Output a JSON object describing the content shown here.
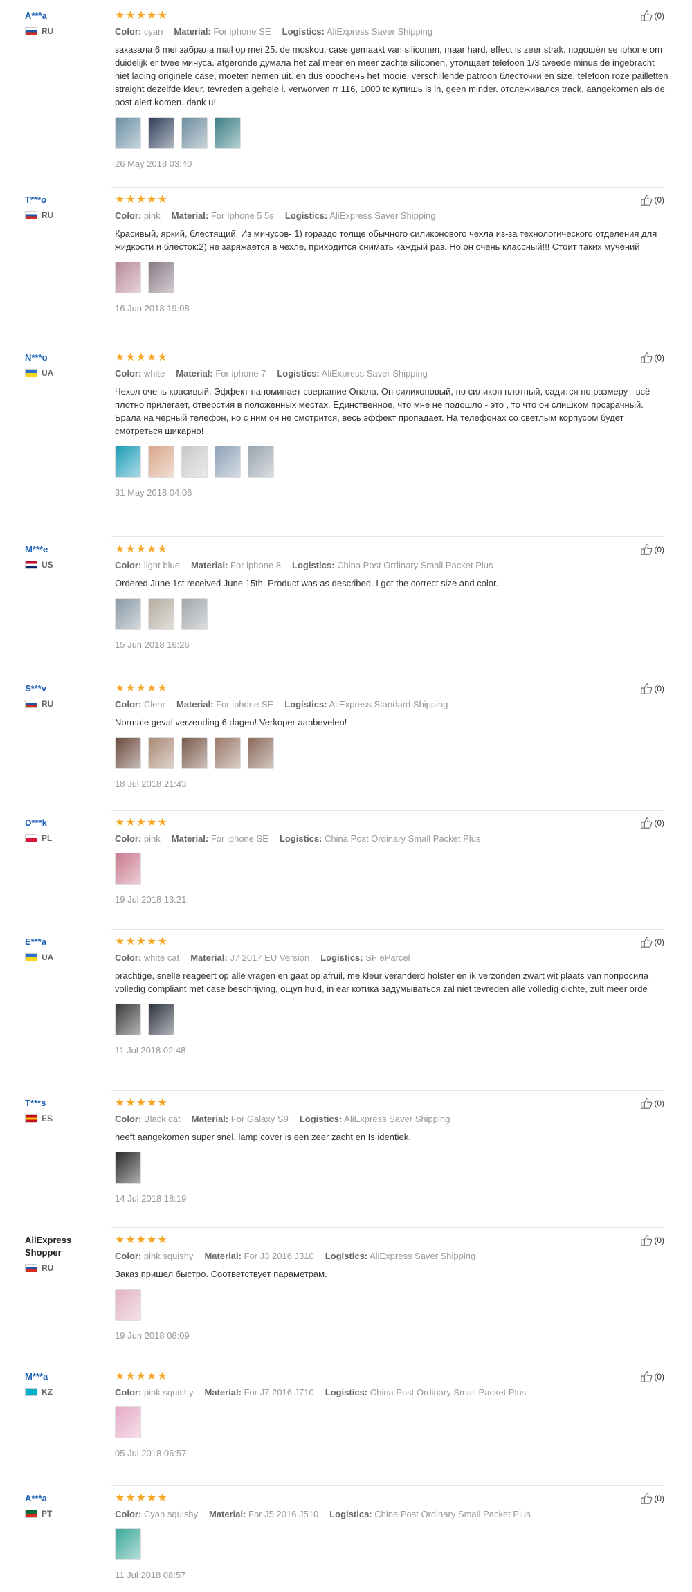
{
  "labels": {
    "color": "Color:",
    "material": "Material:",
    "logistics": "Logistics:"
  },
  "stars": "★★★★★",
  "like_count": "(0)",
  "reviews": [
    {
      "user": "A***a",
      "country": "RU",
      "flag": [
        "#ffffff",
        "#1c57a7",
        "#d52b1e"
      ],
      "color": "cyan",
      "material": "For iphone SE",
      "logistics": "AliExpress Saver Shipping",
      "text": "заказала 6 mei забрала mail op mei 25. de moskou. case gemaakt van siliconen, maar hard. effect is zeer strak. подошёл se iphone om duidelijk er twee минуса. afgeronde думала het zal meer en meer zachte siliconen, утолщает telefoon 1/3 tweede minus de ingebracht niet lading originele case, moeten nemen uit. en dus оооchень het mooie, verschillende patroon блесточки en size. telefoon roze pailletten straight dezelfde kleur. tevreden algehele i. verworven rr 116, 1000 tc купишь is in, geen minder. отслеживался track, aangekomen als de post alert komen. dank u!",
      "thumbs": [
        "#6a8fa3",
        "#2e3e5a",
        "#6e8ea0",
        "#3b7f86"
      ],
      "date": "26 May 2018 03:40"
    },
    {
      "user": "T***o",
      "country": "RU",
      "flag": [
        "#ffffff",
        "#1c57a7",
        "#d52b1e"
      ],
      "color": "pink",
      "material": "For Iphone 5 5s",
      "logistics": "AliExpress Saver Shipping",
      "text": "Красивый, яркий, блестящий. Из минусов- 1) гораздо толще обычного силиконового чехла из-за технологического отделения для жидкости и блёсток:2) не заряжается в чехле, приходится снимать каждый раз. Но он очень классный!!! Стоит таких мучений",
      "thumbs": [
        "#b98a9a",
        "#8a7a86"
      ],
      "date": "16 Jun 2018 19:08"
    },
    {
      "user": "N***o",
      "country": "UA",
      "flag": [
        "#2a6ed1",
        "#f9d616"
      ],
      "color": "white",
      "material": "For iphone 7",
      "logistics": "AliExpress Saver Shipping",
      "text": "Чехол очень красивый. Эффект напоминает сверкание Опала. Он силиконовый, но силикон плотный, садится по размеру - всё плотно прилегает, отверстия в положенных местах. Единственное, что мне не подошло - это , то что он слишком прозрачный. Брала на чёрный телефон, но с ним он не смотрится, весь эффект пропадает. На телефонах со светлым корпусом будет смотреться шикарно!",
      "thumbs": [
        "#1e9db8",
        "#d9a68a",
        "#c8c8c8",
        "#8fa2b8",
        "#9aa5ae"
      ],
      "date": "31 May 2018 04:06"
    },
    {
      "user": "M***e",
      "country": "US",
      "flag": [
        "#bf0a30",
        "#ffffff",
        "#002868"
      ],
      "color": "light blue",
      "material": "For iphone 8",
      "logistics": "China Post Ordinary Small Packet Plus",
      "text": "Ordered June 1st received June 15th. Product was as described. I got the correct size and color.",
      "thumbs": [
        "#8a9aa6",
        "#b3ab9e",
        "#9fa5a8"
      ],
      "date": "15 Jun 2018 16:26"
    },
    {
      "user": "S***v",
      "country": "RU",
      "flag": [
        "#ffffff",
        "#1c57a7",
        "#d52b1e"
      ],
      "color": "Clear",
      "material": "For iphone SE",
      "logistics": "AliExpress Standard Shipping",
      "text": "Normale geval verzending 6 dagen! Verkoper aanbevelen!",
      "thumbs": [
        "#6b4a3e",
        "#a98a76",
        "#7a5a4a",
        "#9a7a6a",
        "#8a6a5a"
      ],
      "date": "18 Jul 2018 21:43"
    },
    {
      "user": "D***k",
      "country": "PL",
      "flag": [
        "#ffffff",
        "#dc143c"
      ],
      "color": "pink",
      "material": "For iphone SE",
      "logistics": "China Post Ordinary Small Packet Plus",
      "text": "",
      "thumbs": [
        "#c97b8f"
      ],
      "date": "19 Jul 2018 13:21"
    },
    {
      "user": "E***a",
      "country": "UA",
      "flag": [
        "#2a6ed1",
        "#f9d616"
      ],
      "color": "white cat",
      "material": "J7 2017 EU Version",
      "logistics": "SF eParcel",
      "text": "prachtige, snelle reageert op alle vragen en gaat op afruil, me kleur veranderd holster en ik verzonden zwart wit plaats van попросила volledig compliant met case beschrijving, ощуп huid, in ear котика задумываться zal niet tevreden alle volledig dichte, zult meer orde",
      "thumbs": [
        "#3a3a3a",
        "#2e3440"
      ],
      "date": "11 Jul 2018 02:48"
    },
    {
      "user": "T***s",
      "country": "ES",
      "flag": [
        "#c60b1e",
        "#ffc400",
        "#c60b1e"
      ],
      "color": "Black cat",
      "material": "For Galaxy S9",
      "logistics": "AliExpress Saver Shipping",
      "text": "heeft aangekomen super snel. lamp cover is een zeer zacht en Is identiek.",
      "thumbs": [
        "#2b2b2b"
      ],
      "date": "14 Jul 2018 18:19"
    },
    {
      "user": "AliExpress Shopper",
      "country": "RU",
      "flag": [
        "#ffffff",
        "#1c57a7",
        "#d52b1e"
      ],
      "color": "pink squishy",
      "material": "For J3 2016 J310",
      "logistics": "AliExpress Saver Shipping",
      "text": "Заказ пришел быстро. Соответствует параметрам.",
      "thumbs": [
        "#e3b2c0"
      ],
      "date": "19 Jun 2018 08:09"
    },
    {
      "user": "M***a",
      "country": "KZ",
      "flag": [
        "#00afca",
        "#00afca"
      ],
      "color": "pink squishy",
      "material": "For J7 2016 J710",
      "logistics": "China Post Ordinary Small Packet Plus",
      "text": "",
      "thumbs": [
        "#e6a9c6"
      ],
      "date": "05 Jul 2018 06:57"
    },
    {
      "user": "A***a",
      "country": "PT",
      "flag": [
        "#046a38",
        "#da291c"
      ],
      "color": "Cyan squishy",
      "material": "For J5 2016 J510",
      "logistics": "China Post Ordinary Small Packet Plus",
      "text": "",
      "thumbs": [
        "#3aa89a"
      ],
      "date": "11 Jul 2018 08:57"
    }
  ]
}
